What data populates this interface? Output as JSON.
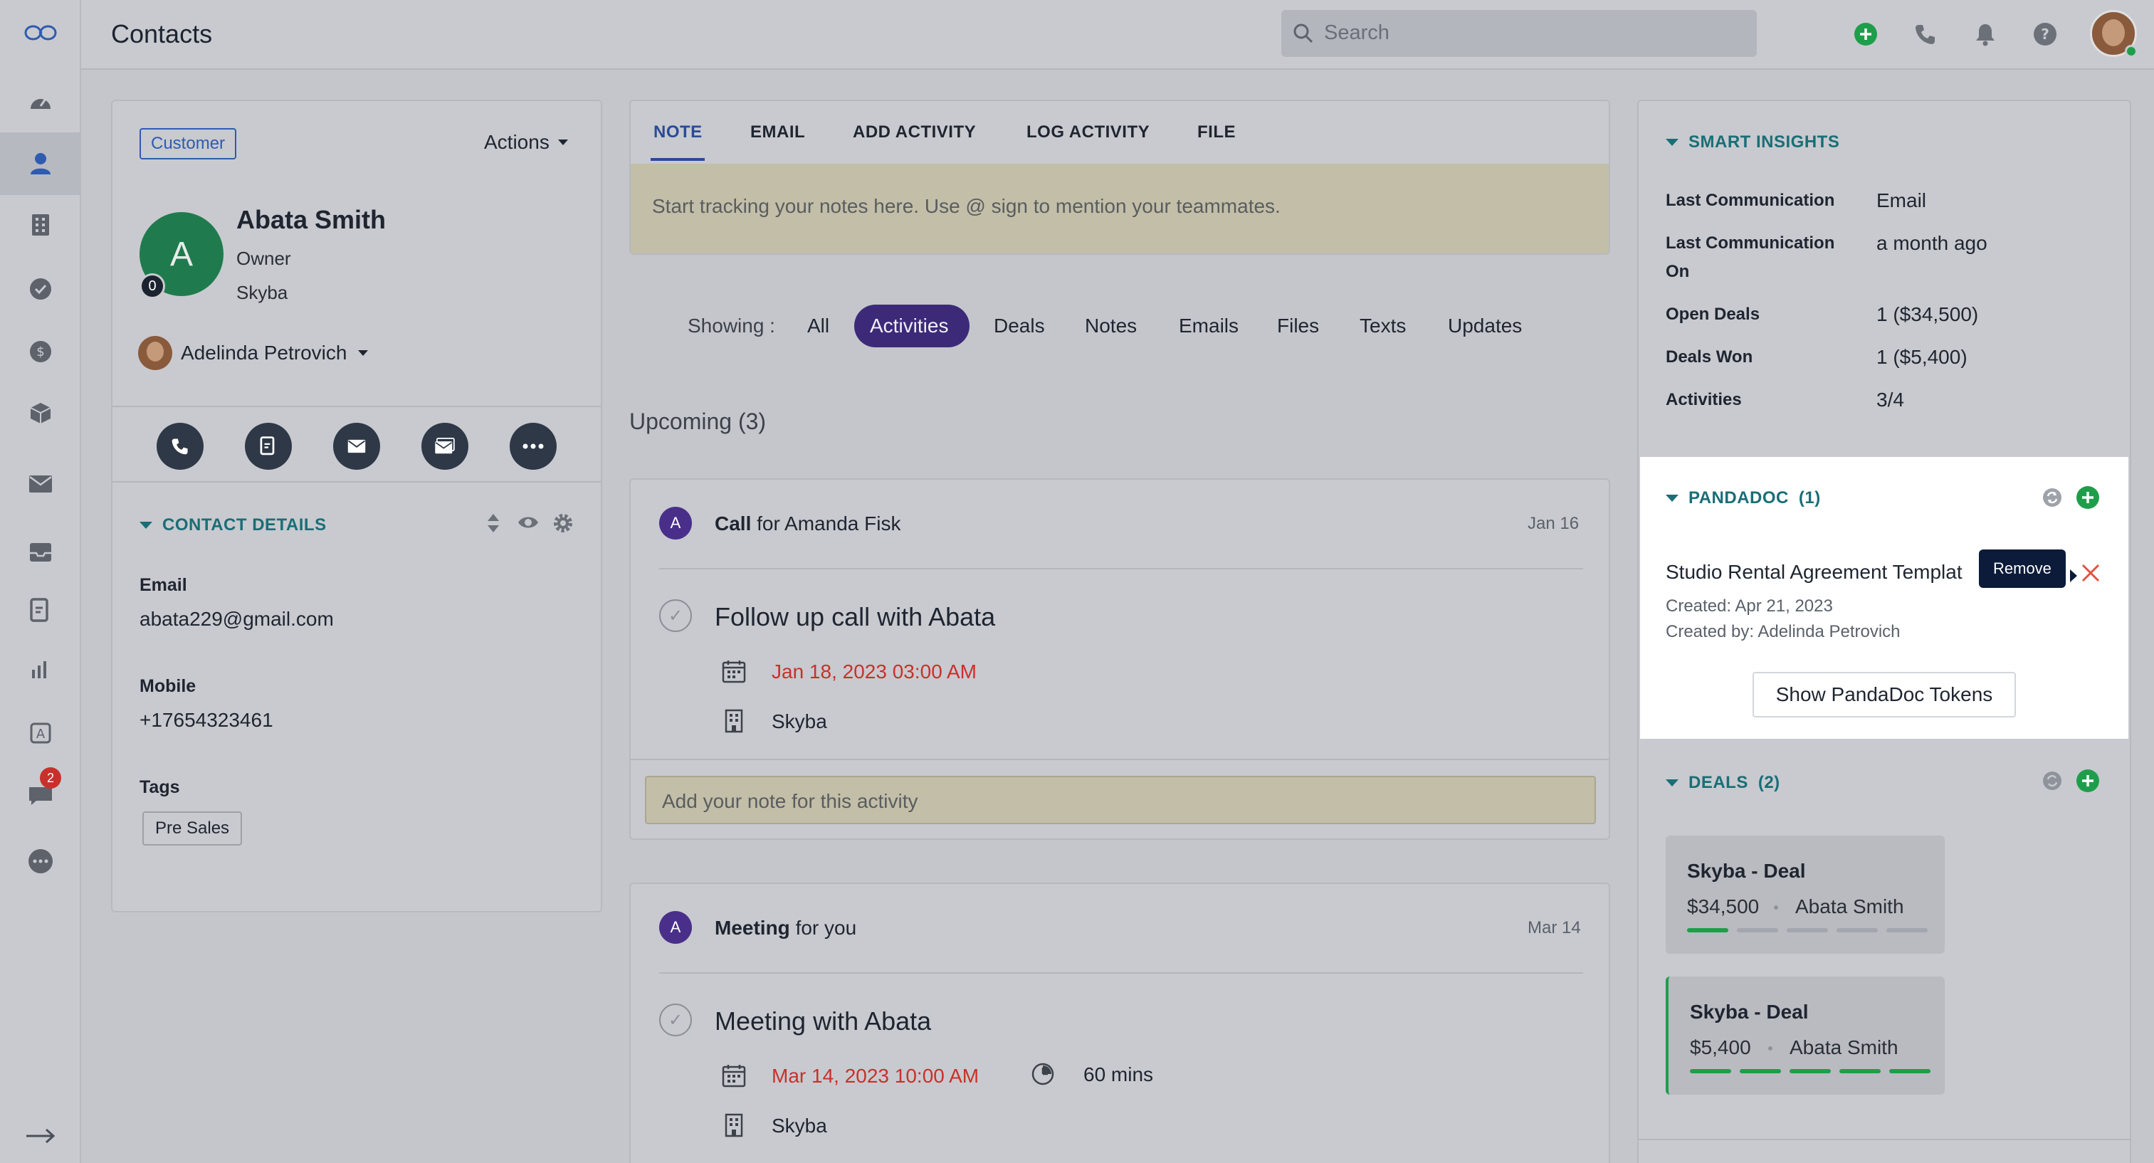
{
  "header": {
    "title": "Contacts",
    "search_placeholder": "Search"
  },
  "sidebar": {
    "chat_badge": "2"
  },
  "contact": {
    "badge": "Customer",
    "actions_label": "Actions",
    "avatar_letter": "A",
    "avatar_count": "0",
    "name": "Abata Smith",
    "role": "Owner",
    "company": "Skyba",
    "owner_name": "Adelinda Petrovich",
    "details_heading": "CONTACT DETAILS",
    "email_label": "Email",
    "email_value": "abata229@gmail.com",
    "mobile_label": "Mobile",
    "mobile_value": "+17654323461",
    "tags_label": "Tags",
    "tag": "Pre Sales"
  },
  "composer": {
    "tabs": [
      "NOTE",
      "EMAIL",
      "ADD ACTIVITY",
      "LOG ACTIVITY",
      "FILE"
    ],
    "placeholder": "Start tracking your notes here. Use @ sign to mention your teammates."
  },
  "filters": {
    "label": "Showing :",
    "items": [
      "All",
      "Activities",
      "Deals",
      "Notes",
      "Emails",
      "Files",
      "Texts",
      "Updates"
    ],
    "active": "Activities"
  },
  "upcoming": {
    "heading": "Upcoming (3)",
    "items": [
      {
        "avatar": "A",
        "type": "Call",
        "for_text": "for Amanda Fisk",
        "date": "Jan 16",
        "title": "Follow up call with Abata",
        "when": "Jan 18, 2023 03:00 AM",
        "company": "Skyba",
        "note_placeholder": "Add your note for this activity"
      },
      {
        "avatar": "A",
        "type": "Meeting",
        "for_text": "for you",
        "date": "Mar 14",
        "title": "Meeting with Abata",
        "when": "Mar 14, 2023 10:00 AM",
        "duration": "60 mins",
        "company": "Skyba"
      }
    ]
  },
  "insights": {
    "heading": "SMART INSIGHTS",
    "rows": [
      {
        "label": "Last Communication",
        "value": "Email"
      },
      {
        "label": "Last Communication",
        "label2": "On",
        "value": "a month ago"
      },
      {
        "label": "Open Deals",
        "value": "1 ($34,500)"
      },
      {
        "label": "Deals Won",
        "value": "1 ($5,400)"
      },
      {
        "label": "Activities",
        "value": "3/4"
      }
    ]
  },
  "pandadoc": {
    "heading": "PANDADOC",
    "count": "(1)",
    "doc_title": "Studio Rental Agreement Templat",
    "created": "Created: Apr 21, 2023",
    "created_by": "Created by: Adelinda Petrovich",
    "tooltip": "Remove",
    "tokens_button": "Show PandaDoc Tokens"
  },
  "deals": {
    "heading": "DEALS",
    "count": "(2)",
    "items": [
      {
        "name": "Skyba - Deal",
        "amount": "$34,500",
        "contact": "Abata Smith",
        "progress": 0.2
      },
      {
        "name": "Skyba - Deal",
        "amount": "$5,400",
        "contact": "Abata Smith",
        "progress": 1.0
      }
    ]
  },
  "colors": {
    "accent_green": "#1e9e4a",
    "teal": "#1a6e76",
    "active_pill": "#3c2a78",
    "danger": "#c8312b"
  }
}
